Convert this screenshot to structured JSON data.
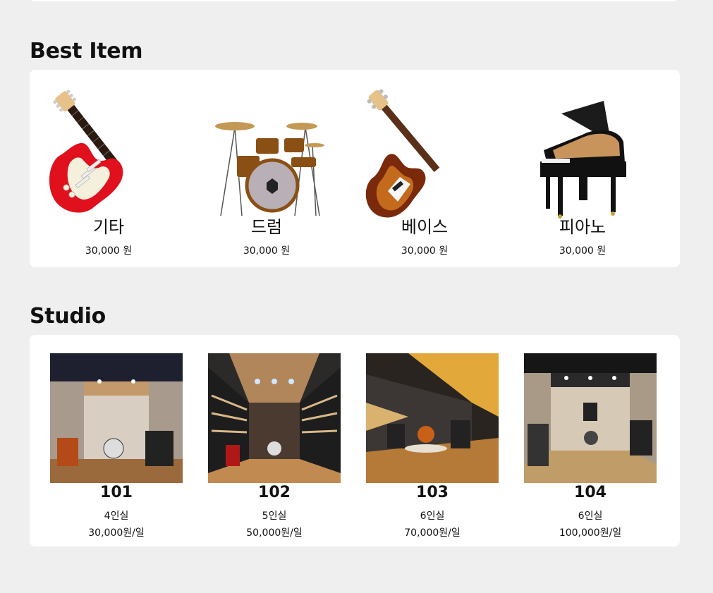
{
  "best": {
    "title": "Best Item",
    "items": [
      {
        "name": "기타",
        "price": "30,000 원",
        "icon": "electric-guitar"
      },
      {
        "name": "드럼",
        "price": "30,000 원",
        "icon": "drum-kit"
      },
      {
        "name": "베이스",
        "price": "30,000 원",
        "icon": "bass-guitar"
      },
      {
        "name": "피아노",
        "price": "30,000 원",
        "icon": "grand-piano"
      }
    ]
  },
  "studio": {
    "title": "Studio",
    "rooms": [
      {
        "number": "101",
        "capacity": "4인실",
        "rate": "30,000원/일"
      },
      {
        "number": "102",
        "capacity": "5인실",
        "rate": "50,000원/일"
      },
      {
        "number": "103",
        "capacity": "6인실",
        "rate": "70,000원/일"
      },
      {
        "number": "104",
        "capacity": "6인실",
        "rate": "100,000원/일"
      }
    ]
  },
  "colors": {
    "background": "#efefef",
    "card": "#ffffff",
    "guitar_red": "#e0101c",
    "bass_sunburst": "#7a2a0a"
  }
}
